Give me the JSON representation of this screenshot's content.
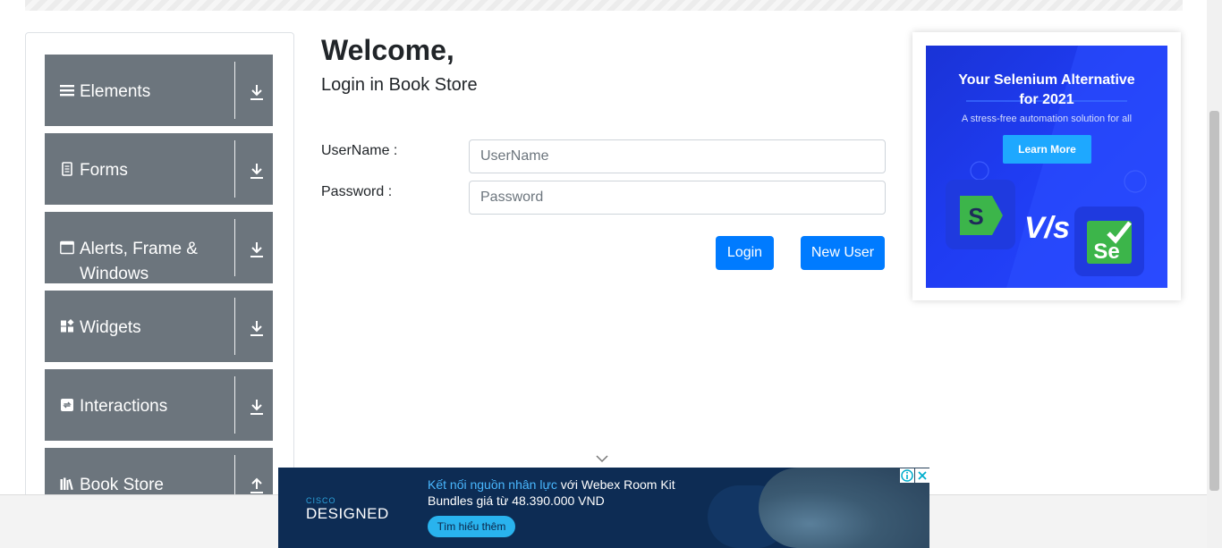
{
  "sidebar": {
    "groups": [
      {
        "label": "Elements",
        "icon": "hamburger-icon",
        "arrow": "download-arrow-icon"
      },
      {
        "label": "Forms",
        "icon": "document-icon",
        "arrow": "download-arrow-icon"
      },
      {
        "label": "Alerts, Frame & Windows",
        "icon": "window-icon",
        "arrow": "download-arrow-icon"
      },
      {
        "label": "Widgets",
        "icon": "widgets-icon",
        "arrow": "download-arrow-icon"
      },
      {
        "label": "Interactions",
        "icon": "sync-icon",
        "arrow": "download-arrow-icon"
      },
      {
        "label": "Book Store",
        "icon": "books-icon",
        "arrow": "upload-arrow-icon"
      }
    ]
  },
  "main": {
    "heading": "Welcome,",
    "subheading": "Login in Book Store",
    "username_label": "UserName :",
    "username_placeholder": "UserName",
    "password_label": "Password :",
    "password_placeholder": "Password",
    "login_button": "Login",
    "new_user_button": "New User"
  },
  "ad_right": {
    "title_line1": "Your Selenium Alternative",
    "title_line2": "for 2021",
    "tagline": "A stress-free automation solution for all",
    "cta": "Learn More",
    "vs_text": "V/s",
    "logo_left": "S",
    "logo_right": "Se"
  },
  "ad_bottom": {
    "brand_top": "CISCO",
    "brand_bottom": "DESIGNED",
    "line1_highlight": "Kết nối nguồn nhân lực",
    "line1_rest": " với Webex Room Kit",
    "line2": "Bundles giá từ 48.390.000 VND",
    "cta": "Tìm hiểu thêm"
  },
  "colors": {
    "sidebar_group_bg": "#6c757d",
    "primary_button": "#007bff",
    "ad_right_bg": "#1f3cf2",
    "ad_bottom_bg": "#0d2c54"
  }
}
